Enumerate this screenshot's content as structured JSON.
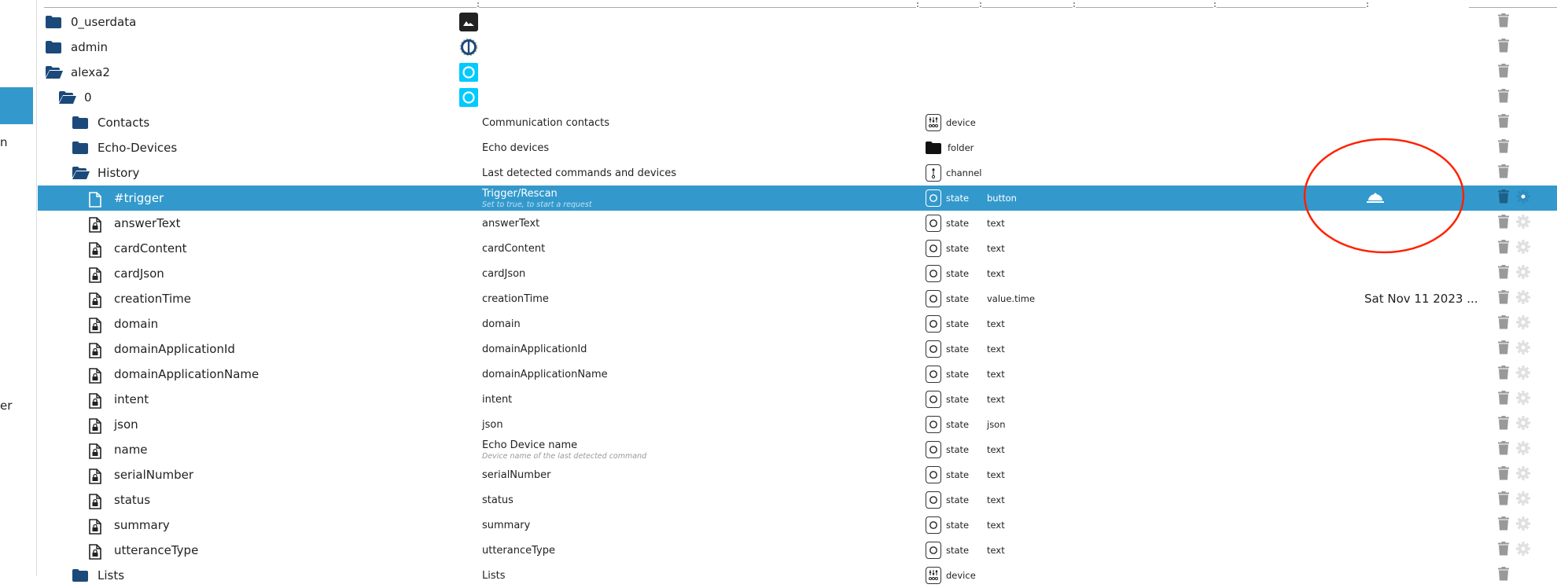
{
  "sidebar": {
    "fragments": [
      "n",
      "er"
    ]
  },
  "colors": {
    "selected": "#3399cc",
    "folder": "#1b4a7a",
    "alexa": "#00caff",
    "trash": "#999999",
    "gear": "#e0e0e0",
    "annotation": "#ff2200"
  },
  "rows": [
    {
      "name": "0_userdata",
      "level": 0,
      "icon": "folder-closed",
      "app": "image",
      "title": "",
      "desc": "",
      "type": "",
      "typeIcon": "",
      "role": "",
      "value": ""
    },
    {
      "name": "admin",
      "level": 0,
      "icon": "folder-closed",
      "app": "iobroker",
      "title": "",
      "desc": "",
      "type": "",
      "typeIcon": "",
      "role": "",
      "value": ""
    },
    {
      "name": "alexa2",
      "level": 0,
      "icon": "folder-open",
      "app": "alexa",
      "title": "",
      "desc": "",
      "type": "",
      "typeIcon": "",
      "role": "",
      "value": ""
    },
    {
      "name": "0",
      "level": 1,
      "icon": "folder-open",
      "app": "alexa",
      "title": "",
      "desc": "",
      "type": "",
      "typeIcon": "",
      "role": "",
      "value": ""
    },
    {
      "name": "Contacts",
      "level": 2,
      "icon": "folder-closed",
      "app": "",
      "title": "Communication contacts",
      "desc": "",
      "type": "device",
      "typeIcon": "device",
      "role": "",
      "value": ""
    },
    {
      "name": "Echo-Devices",
      "level": 2,
      "icon": "folder-closed",
      "app": "",
      "title": "Echo devices",
      "desc": "",
      "type": "folder",
      "typeIcon": "folder",
      "role": "",
      "value": ""
    },
    {
      "name": "History",
      "level": 2,
      "icon": "folder-open",
      "app": "",
      "title": "Last detected commands and devices",
      "desc": "",
      "type": "channel",
      "typeIcon": "channel",
      "role": "",
      "value": ""
    },
    {
      "name": "#trigger",
      "level": 3,
      "icon": "file",
      "app": "",
      "title": "Trigger/Rescan",
      "desc": "Set to true, to start a request",
      "type": "state",
      "typeIcon": "state",
      "role": "button",
      "value": "",
      "bell": true,
      "selected": true
    },
    {
      "name": "answerText",
      "level": 3,
      "icon": "file-lock",
      "app": "",
      "title": "answerText",
      "desc": "",
      "type": "state",
      "typeIcon": "state",
      "role": "text",
      "value": ""
    },
    {
      "name": "cardContent",
      "level": 3,
      "icon": "file-lock",
      "app": "",
      "title": "cardContent",
      "desc": "",
      "type": "state",
      "typeIcon": "state",
      "role": "text",
      "value": ""
    },
    {
      "name": "cardJson",
      "level": 3,
      "icon": "file-lock",
      "app": "",
      "title": "cardJson",
      "desc": "",
      "type": "state",
      "typeIcon": "state",
      "role": "text",
      "value": ""
    },
    {
      "name": "creationTime",
      "level": 3,
      "icon": "file-lock",
      "app": "",
      "title": "creationTime",
      "desc": "",
      "type": "state",
      "typeIcon": "state",
      "role": "value.time",
      "value": "Sat Nov 11 2023 ..."
    },
    {
      "name": "domain",
      "level": 3,
      "icon": "file-lock",
      "app": "",
      "title": "domain",
      "desc": "",
      "type": "state",
      "typeIcon": "state",
      "role": "text",
      "value": ""
    },
    {
      "name": "domainApplicationId",
      "level": 3,
      "icon": "file-lock",
      "app": "",
      "title": "domainApplicationId",
      "desc": "",
      "type": "state",
      "typeIcon": "state",
      "role": "text",
      "value": ""
    },
    {
      "name": "domainApplicationName",
      "level": 3,
      "icon": "file-lock",
      "app": "",
      "title": "domainApplicationName",
      "desc": "",
      "type": "state",
      "typeIcon": "state",
      "role": "text",
      "value": ""
    },
    {
      "name": "intent",
      "level": 3,
      "icon": "file-lock",
      "app": "",
      "title": "intent",
      "desc": "",
      "type": "state",
      "typeIcon": "state",
      "role": "text",
      "value": ""
    },
    {
      "name": "json",
      "level": 3,
      "icon": "file-lock",
      "app": "",
      "title": "json",
      "desc": "",
      "type": "state",
      "typeIcon": "state",
      "role": "json",
      "value": ""
    },
    {
      "name": "name",
      "level": 3,
      "icon": "file-lock",
      "app": "",
      "title": "Echo Device name",
      "desc": "Device name of the last detected command",
      "type": "state",
      "typeIcon": "state",
      "role": "text",
      "value": ""
    },
    {
      "name": "serialNumber",
      "level": 3,
      "icon": "file-lock",
      "app": "",
      "title": "serialNumber",
      "desc": "",
      "type": "state",
      "typeIcon": "state",
      "role": "text",
      "value": ""
    },
    {
      "name": "status",
      "level": 3,
      "icon": "file-lock",
      "app": "",
      "title": "status",
      "desc": "",
      "type": "state",
      "typeIcon": "state",
      "role": "text",
      "value": ""
    },
    {
      "name": "summary",
      "level": 3,
      "icon": "file-lock",
      "app": "",
      "title": "summary",
      "desc": "",
      "type": "state",
      "typeIcon": "state",
      "role": "text",
      "value": ""
    },
    {
      "name": "utteranceType",
      "level": 3,
      "icon": "file-lock",
      "app": "",
      "title": "utteranceType",
      "desc": "",
      "type": "state",
      "typeIcon": "state",
      "role": "text",
      "value": ""
    },
    {
      "name": "Lists",
      "level": 2,
      "icon": "folder-closed",
      "app": "",
      "title": "Lists",
      "desc": "",
      "type": "device",
      "typeIcon": "device",
      "role": "",
      "value": ""
    }
  ]
}
